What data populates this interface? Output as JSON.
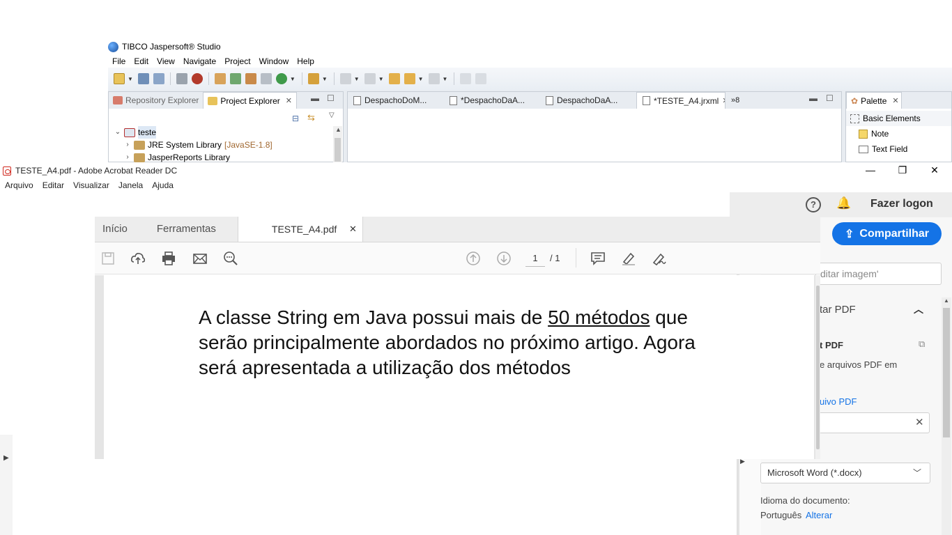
{
  "jaspersoft": {
    "title": "TIBCO Jaspersoft® Studio",
    "menu": [
      "File",
      "Edit",
      "View",
      "Navigate",
      "Project",
      "Window",
      "Help"
    ],
    "left_tabs": [
      {
        "label": "Repository Explorer",
        "active": false
      },
      {
        "label": "Project Explorer",
        "active": true
      }
    ],
    "tree": {
      "root": "teste",
      "items": [
        {
          "label": "JRE System Library",
          "suffix": "[JavaSE-1.8]"
        },
        {
          "label": "JasperReports Library",
          "suffix": ""
        }
      ]
    },
    "editor_tabs": [
      {
        "label": "DespachoDoM..."
      },
      {
        "label": "*DespachoDaA..."
      },
      {
        "label": "DespachoDaA..."
      },
      {
        "label": "*TESTE_A4.jrxml",
        "active": true
      }
    ],
    "more_tabs": "»8",
    "palette": {
      "title": "Palette",
      "items": [
        "Basic Elements",
        "Note",
        "Text Field"
      ]
    }
  },
  "acrobat": {
    "window_title": "TESTE_A4.pdf - Adobe Acrobat Reader DC",
    "menu": [
      "Arquivo",
      "Editar",
      "Visualizar",
      "Janela",
      "Ajuda"
    ],
    "tabs": {
      "home": "Início",
      "tools": "Ferramentas",
      "document": "TESTE_A4.pdf"
    },
    "header": {
      "help_icon": "?",
      "login": "Fazer logon",
      "share": "Compartilhar"
    },
    "page_nav": {
      "current": "1",
      "total": "/ 1"
    },
    "document": {
      "text_before": "A classe String em Java possui mais de ",
      "text_underlined": "50 métodos",
      "text_after": " que serão principalmente abordados no próximo artigo. Agora será apresentada a utilização dos métodos"
    },
    "right_panel": {
      "search_placeholder": "ditar imagem'",
      "section_title": "tar PDF",
      "subheading": "t PDF",
      "desc": "e arquivos PDF em",
      "link": "uivo PDF",
      "format_select": "Microsoft Word (*.docx)",
      "language_label": "Idioma do documento:",
      "language_value": "Português",
      "language_change": "Alterar"
    }
  }
}
